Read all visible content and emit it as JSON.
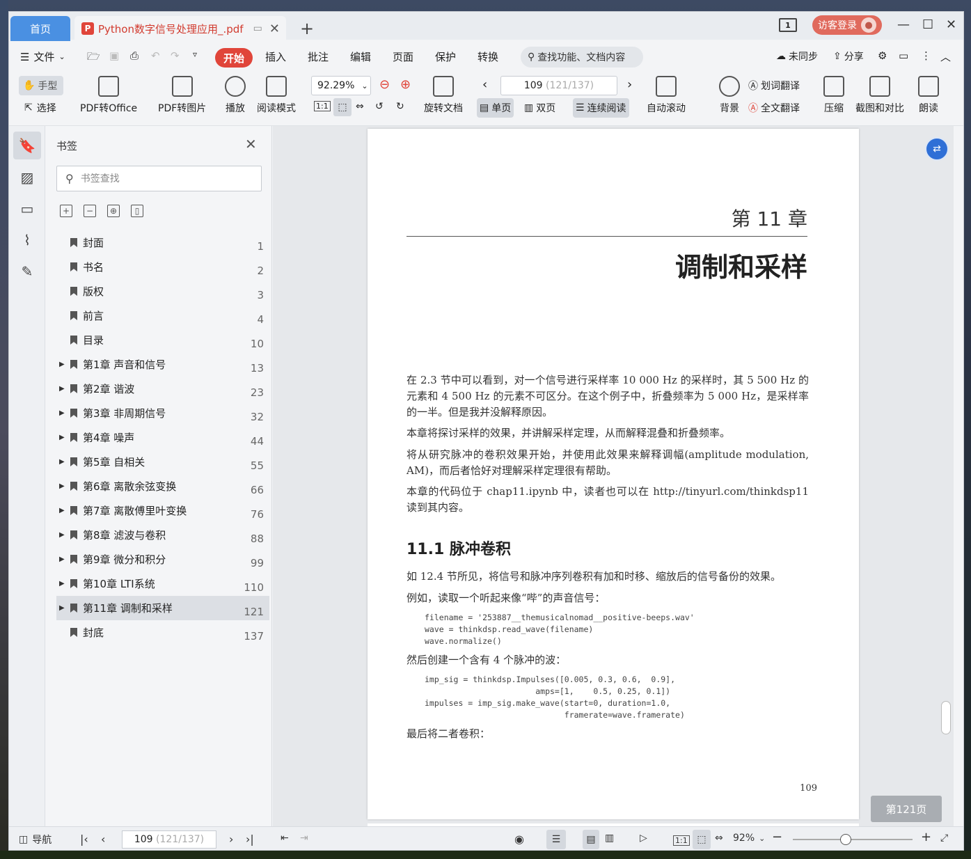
{
  "titlebar": {
    "home_tab": "首页",
    "doc_tab": "Python数字信号处理应用_.pdf",
    "page_indicator": "1",
    "login": "访客登录"
  },
  "menu": {
    "file": "文件",
    "active": "开始",
    "items": [
      "插入",
      "批注",
      "编辑",
      "页面",
      "保护",
      "转换"
    ],
    "search": "查找功能、文档内容",
    "sync": "未同步",
    "share": "分享"
  },
  "toolbar": {
    "hand": "手型",
    "select": "选择",
    "pdf_to_office": "PDF转Office",
    "pdf_to_image": "PDF转图片",
    "play": "播放",
    "read_mode": "阅读模式",
    "zoom": "92.29%",
    "rotate_doc": "旋转文档",
    "page_current": "109",
    "page_extra": "(121/137)",
    "single_page": "单页",
    "double_page": "双页",
    "continuous": "连续阅读",
    "auto_scroll": "自动滚动",
    "background": "背景",
    "word_translate": "划词翻译",
    "full_translate": "全文翻译",
    "compress": "压缩",
    "screenshot_compare": "截图和对比",
    "read_aloud": "朗读",
    "fit_1to1": "1:1"
  },
  "bookmarks": {
    "title": "书签",
    "search_placeholder": "书签查找",
    "items": [
      {
        "label": "封面",
        "page": "1",
        "expandable": false
      },
      {
        "label": "书名",
        "page": "2",
        "expandable": false
      },
      {
        "label": "版权",
        "page": "3",
        "expandable": false
      },
      {
        "label": "前言",
        "page": "4",
        "expandable": false
      },
      {
        "label": "目录",
        "page": "10",
        "expandable": false
      },
      {
        "label": "第1章 声音和信号",
        "page": "13",
        "expandable": true
      },
      {
        "label": "第2章 谐波",
        "page": "23",
        "expandable": true
      },
      {
        "label": "第3章 非周期信号",
        "page": "32",
        "expandable": true
      },
      {
        "label": "第4章 噪声",
        "page": "44",
        "expandable": true
      },
      {
        "label": "第5章 自相关",
        "page": "55",
        "expandable": true
      },
      {
        "label": "第6章 离散余弦变换",
        "page": "66",
        "expandable": true
      },
      {
        "label": "第7章 离散傅里叶变换",
        "page": "76",
        "expandable": true
      },
      {
        "label": "第8章 滤波与卷积",
        "page": "88",
        "expandable": true
      },
      {
        "label": "第9章 微分和积分",
        "page": "99",
        "expandable": true
      },
      {
        "label": "第10章 LTI系统",
        "page": "110",
        "expandable": true
      },
      {
        "label": "第11章 调制和采样",
        "page": "121",
        "expandable": true,
        "selected": true
      },
      {
        "label": "封底",
        "page": "137",
        "expandable": false
      }
    ]
  },
  "page": {
    "chapter_no": "第 11 章",
    "chapter_title": "调制和采样",
    "p1": "在 2.3 节中可以看到，对一个信号进行采样率 10 000 Hz 的采样时，其 5 500 Hz 的元素和 4 500 Hz 的元素不可区分。在这个例子中，折叠频率为 5 000 Hz，是采样率的一半。但是我并没解释原因。",
    "p2": "本章将探讨采样的效果，并讲解采样定理，从而解释混叠和折叠频率。",
    "p3": "将从研究脉冲的卷积效果开始，并使用此效果来解释调幅(amplitude modulation, AM)，而后者恰好对理解采样定理很有帮助。",
    "p4": "本章的代码位于 chap11.ipynb 中，读者也可以在 http://tinyurl.com/thinkdsp11 读到其内容。",
    "section": "11.1   脉冲卷积",
    "p5": "如 12.4 节所见，将信号和脉冲序列卷积有加和时移、缩放后的信号备份的效果。",
    "p6": "例如，读取一个听起来像“哔”的声音信号：",
    "code1": "filename = '253887__themusicalnomad__positive-beeps.wav'\nwave = thinkdsp.read_wave(filename)\nwave.normalize()",
    "p7": "然后创建一个含有 4 个脉冲的波：",
    "code2": "imp_sig = thinkdsp.Impulses([0.005, 0.3, 0.6,  0.9],\n                       amps=[1,    0.5, 0.25, 0.1])\nimpulses = imp_sig.make_wave(start=0, duration=1.0,\n                             framerate=wave.framerate)",
    "p8": "最后将二者卷积：",
    "page_number": "109"
  },
  "toast": "第121页",
  "status": {
    "nav": "导航",
    "page_current": "109",
    "page_extra": "(121/137)",
    "zoom": "92%",
    "fit_1to1": "1:1"
  }
}
